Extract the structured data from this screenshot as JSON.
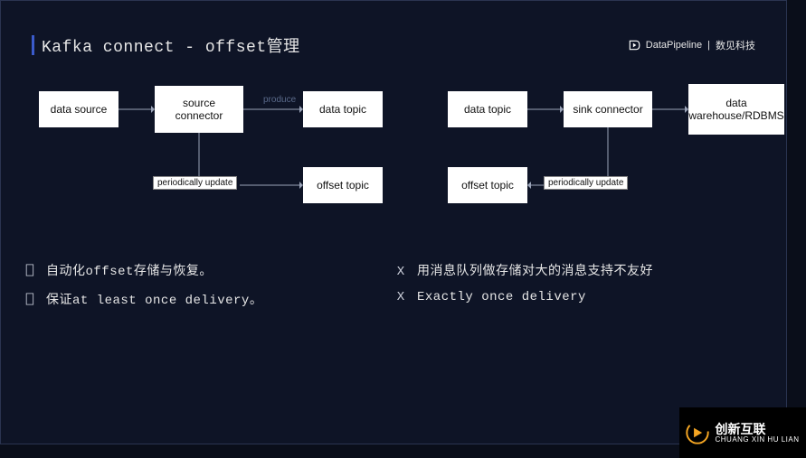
{
  "title": "Kafka connect - offset管理",
  "header_brand": "DataPipeline",
  "header_company": "数见科技",
  "diagram": {
    "left": {
      "nodes": {
        "data_source": "data source",
        "source_connector": "source connector",
        "data_topic": "data topic",
        "offset_topic": "offset topic"
      },
      "edge_labels": {
        "periodically_update": "periodically update",
        "produce": "produce"
      }
    },
    "right": {
      "nodes": {
        "data_topic": "data topic",
        "sink_connector": "sink connector",
        "warehouse": "data warehouse/RDBMS",
        "offset_topic": "offset topic"
      },
      "edge_labels": {
        "periodically_update": "periodically update"
      }
    }
  },
  "bullets": {
    "pros": [
      "自动化offset存储与恢复。",
      "保证at least once delivery。"
    ],
    "cons": [
      "用消息队列做存储对大的消息支持不友好",
      "Exactly once delivery"
    ],
    "markers": {
      "pro": "⎕",
      "con": "X"
    }
  },
  "watermark": {
    "brand": "创新互联",
    "sub": "CHUANG XIN HU LIAN"
  }
}
